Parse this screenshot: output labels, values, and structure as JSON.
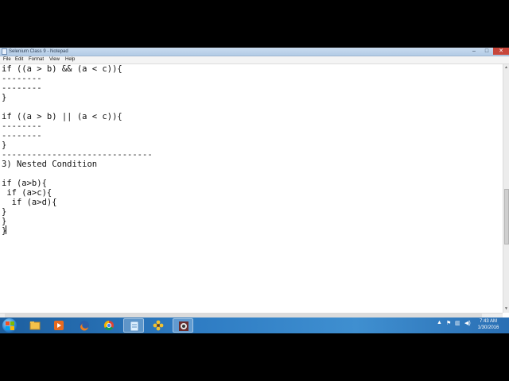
{
  "window": {
    "title": "Selenium Class 9 - Notepad",
    "controls": {
      "minimize": "–",
      "maximize": "□",
      "close": "✕"
    }
  },
  "menu": [
    "File",
    "Edit",
    "Format",
    "View",
    "Help"
  ],
  "editor": {
    "lines": [
      "if ((a > b) && (a < c)){",
      "--------",
      "--------",
      "}",
      "",
      "if ((a > b) || (a < c)){",
      "--------",
      "--------",
      "}",
      "------------------------------",
      "3) Nested Condition",
      "",
      "if (a>b){",
      " if (a>c){",
      "  if (a>d){",
      "}",
      "}",
      "}"
    ]
  },
  "taskbar": {
    "apps": [
      {
        "name": "explorer",
        "icon": "folder-icon",
        "active": false
      },
      {
        "name": "media-player",
        "icon": "media-player-icon",
        "active": false
      },
      {
        "name": "firefox",
        "icon": "firefox-icon",
        "active": false
      },
      {
        "name": "chrome",
        "icon": "chrome-icon",
        "active": false
      },
      {
        "name": "notepad",
        "icon": "notepad-icon",
        "active": true
      },
      {
        "name": "flower-app",
        "icon": "flower-icon",
        "active": false
      },
      {
        "name": "camera-app",
        "icon": "camera-icon",
        "active": true
      }
    ],
    "tray_icons": [
      "show-hidden-icon",
      "action-center-flag-icon",
      "network-icon",
      "volume-icon"
    ],
    "time": "7:43 AM",
    "date": "1/30/2016"
  }
}
